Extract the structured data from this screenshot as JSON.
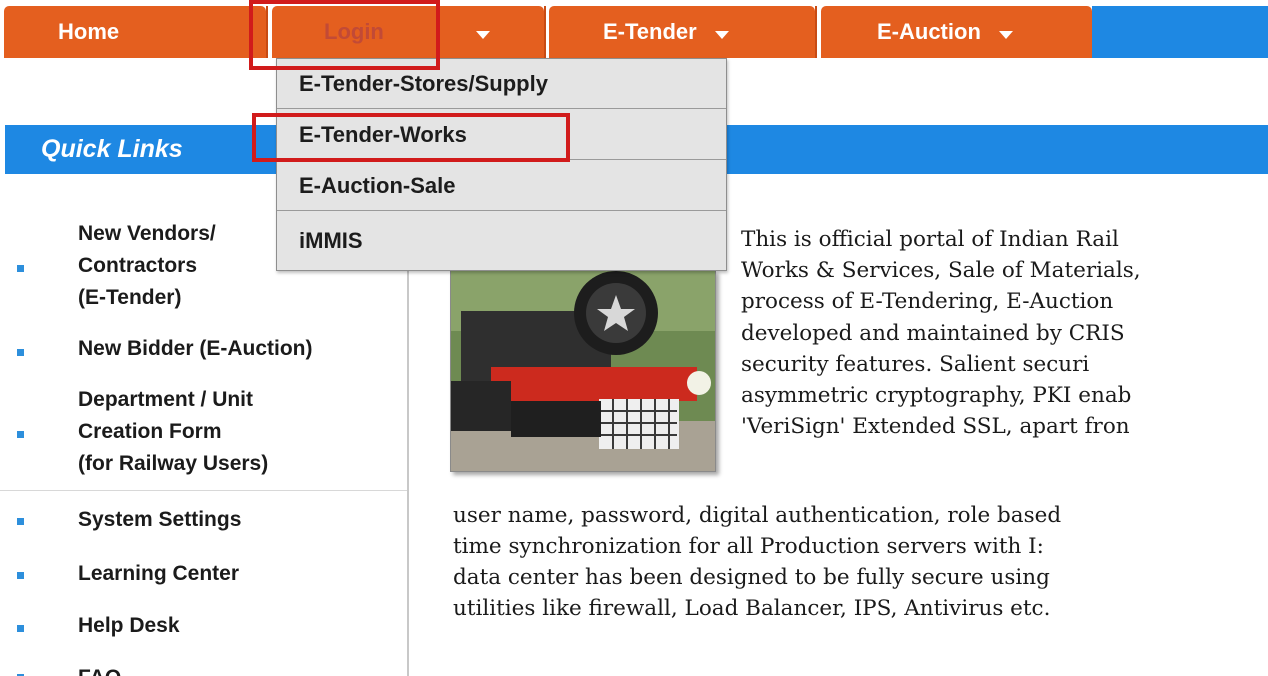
{
  "nav": {
    "tabs": [
      {
        "label": "Home",
        "has_caret": false
      },
      {
        "label": "Login",
        "has_caret": true
      },
      {
        "label": "E-Tender",
        "has_caret": true
      },
      {
        "label": "E-Auction",
        "has_caret": true
      }
    ]
  },
  "dropdown": {
    "items": [
      "E-Tender-Stores/Supply",
      "E-Tender-Works",
      "E-Auction-Sale",
      "iMMIS"
    ]
  },
  "quick_links": {
    "title": "Quick Links",
    "items": [
      {
        "lines": [
          "New Vendors/",
          "Contractors",
          "(E-Tender)"
        ]
      },
      {
        "lines": [
          "New Bidder (E-Auction)"
        ]
      },
      {
        "lines": [
          "Department / Unit",
          "Creation Form",
          "(for Railway Users)"
        ]
      },
      {
        "lines": [
          "System Settings"
        ]
      },
      {
        "lines": [
          "Learning Center"
        ]
      },
      {
        "lines": [
          "Help Desk"
        ]
      },
      {
        "lines": [
          "FAQ"
        ]
      }
    ]
  },
  "content": {
    "paragraph_lines": [
      "This is official portal of Indian Rail",
      "Works & Services, Sale of Materials,",
      "process of E-Tendering, E-Auction",
      "developed and maintained by CRIS",
      "security   features.   Salient   securi",
      "asymmetric cryptography, PKI enab",
      "'VeriSign' Extended SSL, apart fron",
      "user name, password, digital authentication, role based",
      "time synchronization for all Production servers with I:",
      "data center has been designed to be fully secure using",
      "utilities like firewall, Load Balancer, IPS, Antivirus etc."
    ]
  },
  "colors": {
    "nav_orange": "#e45f1f",
    "nav_blue": "#1e88e3",
    "highlight_red": "#d11b1b",
    "bullet_blue": "#2d8fdc"
  }
}
